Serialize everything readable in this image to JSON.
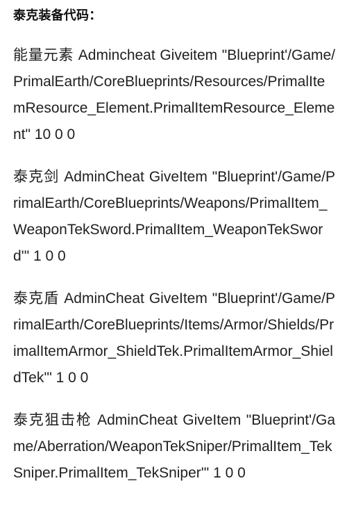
{
  "page": {
    "title": "泰克装备代码：",
    "background_color": "#ffffff",
    "text_color": "#1f1f1f"
  },
  "codes": [
    {
      "item_name": "能量元素",
      "command": "Admincheat",
      "subcommand": "Giveitem",
      "blueprint_path": "\"Blueprint'/Game/PrimalEarth/CoreBlueprints/Resources/PrimalItemResource_Element.PrimalItemResource_Element\"",
      "args": "10 0 0",
      "full_text": "能量元素 Admincheat Giveitem \"Blueprint'/Game/PrimalEarth/CoreBlueprints/Resources/PrimalItemResource_Element.PrimalItemResource_Element\" 10 0 0"
    },
    {
      "item_name": "泰克剑",
      "command": "AdminCheat",
      "subcommand": "GiveItem",
      "blueprint_path": "\"Blueprint'/Game/PrimalEarth/CoreBlueprints/Weapons/PrimalItem_WeaponTekSword.PrimalItem_WeaponTekSword'\"",
      "args": "1 0 0",
      "full_text": "泰克剑 AdminCheat GiveItem \"Blueprint'/Game/PrimalEarth/CoreBlueprints/Weapons/PrimalItem_WeaponTekSword.PrimalItem_WeaponTekSword'\" 1 0 0"
    },
    {
      "item_name": "泰克盾",
      "command": "AdminCheat",
      "subcommand": "GiveItem",
      "blueprint_path": "\"Blueprint'/Game/PrimalEarth/CoreBlueprints/Items/Armor/Shields/PrimalItemArmor_ShieldTek.PrimalItemArmor_ShieldTek'\"",
      "args": "1 0 0",
      "full_text": "泰克盾 AdminCheat GiveItem \"Blueprint'/Game/PrimalEarth/CoreBlueprints/Items/Armor/Shields/PrimalItemArmor_ShieldTek.PrimalItemArmor_ShieldTek'\" 1 0 0"
    },
    {
      "item_name": "泰克狙击枪",
      "command": "AdminCheat",
      "subcommand": "GiveItem",
      "blueprint_path": "\"Blueprint'/Game/Aberration/WeaponTekSniper/PrimalItem_TekSniper.PrimalItem_TekSniper'\"",
      "args": "1 0 0",
      "full_text": "泰克狙击枪 AdminCheat GiveItem \"Blueprint'/Game/Aberration/WeaponTekSniper/PrimalItem_TekSniper.PrimalItem_TekSniper'\" 1 0 0"
    }
  ]
}
